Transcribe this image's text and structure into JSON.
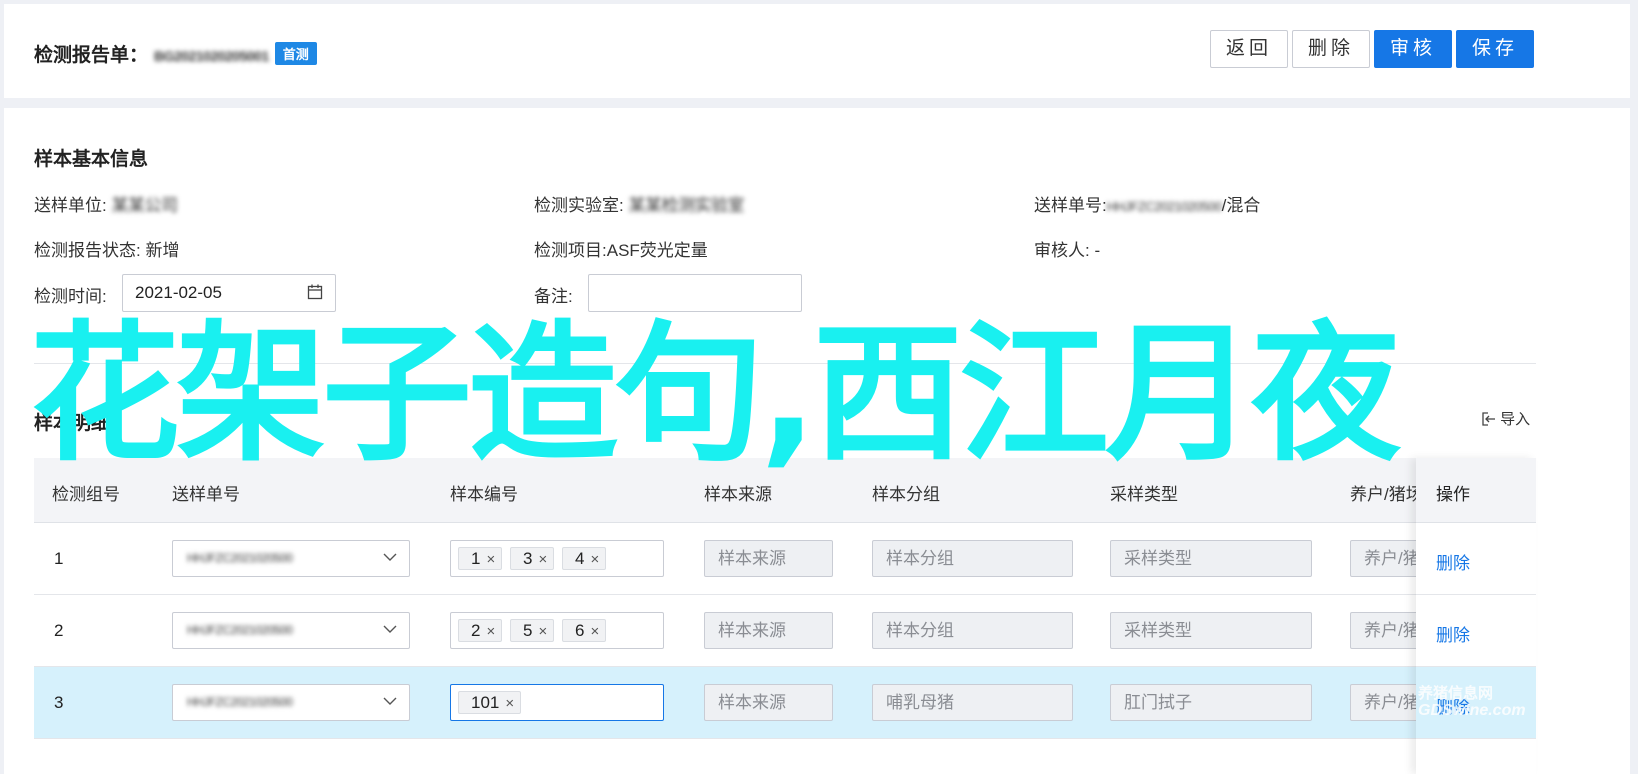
{
  "header": {
    "title": "检测报告单：",
    "report_code": "BG2021020205001",
    "badge": "首测",
    "buttons": {
      "back": "返回",
      "delete": "删除",
      "review": "审核",
      "save": "保存"
    }
  },
  "sample_info": {
    "title": "样本基本信息",
    "submit_unit_label": "送样单位:",
    "submit_unit_value": "某某公司",
    "lab_label": "检测实验室:",
    "lab_value": "某某检测实验室",
    "submit_no_label": "送样单号:",
    "submit_no_value": "HHJFZC2021020500",
    "submit_no_suffix": "/混合",
    "status_label": "检测报告状态:",
    "status_value": "新增",
    "item_label": "检测项目:",
    "item_value": "ASF荧光定量",
    "reviewer_label": "审核人:",
    "reviewer_value": "-",
    "time_label": "检测时间:",
    "time_value": "2021-02-05",
    "note_label": "备注:",
    "note_value": ""
  },
  "overlay_text": "花架子造句,西江月夜",
  "detail": {
    "title": "样本明细",
    "import_label": "导入"
  },
  "table": {
    "columns": [
      "检测组号",
      "送样单号",
      "样本编号",
      "样本来源",
      "样本分组",
      "采样类型",
      "养户/猪场",
      "操作"
    ],
    "rows": [
      {
        "num": "1",
        "submit_no": "HHJFZC2021020500",
        "tags": [
          "1",
          "3",
          "4"
        ],
        "source": "样本来源",
        "group": "样本分组",
        "type": "采样类型",
        "farm": "养户/猪场",
        "action": "删除"
      },
      {
        "num": "2",
        "submit_no": "HHJFZC2021020500",
        "tags": [
          "2",
          "5",
          "6"
        ],
        "source": "样本来源",
        "group": "样本分组",
        "type": "采样类型",
        "farm": "养户/猪场",
        "action": "删除"
      },
      {
        "num": "3",
        "submit_no": "HHJFZC2021020500",
        "tags": [
          "101"
        ],
        "source": "样本来源",
        "group": "哺乳母猪",
        "type": "肛门拭子",
        "farm": "养户/猪场",
        "action": "删除"
      }
    ],
    "tag_close": "×"
  },
  "watermark": {
    "line1": "养猪信息网",
    "line2": "GDSwine.com"
  },
  "colors": {
    "primary": "#1677e6",
    "overlay": "#19f0f0",
    "selected_row": "#d6f1fc"
  }
}
